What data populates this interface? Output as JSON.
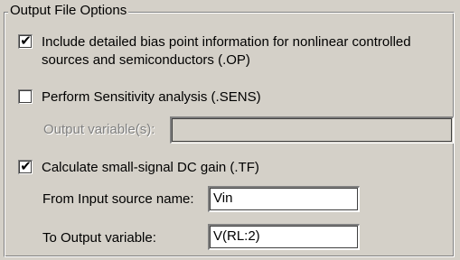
{
  "group": {
    "title": "Output File Options"
  },
  "bias_point": {
    "checked": true,
    "label_line1": "Include detailed bias point information for nonlinear controlled",
    "label_line2": "sources and semiconductors (.OP)"
  },
  "sensitivity": {
    "checked": false,
    "label": "Perform Sensitivity analysis (.SENS)",
    "output_variables_label": "Output variable(s):",
    "output_variables_value": "",
    "enabled": false
  },
  "tf": {
    "checked": true,
    "label": "Calculate small-signal DC gain (.TF)",
    "from_label": "From Input source name:",
    "from_value": "Vin",
    "to_label": "To Output variable:",
    "to_value": "V(RL:2)"
  },
  "colors": {
    "dialog_bg": "#d4d0c8",
    "disabled_text": "#808080"
  }
}
